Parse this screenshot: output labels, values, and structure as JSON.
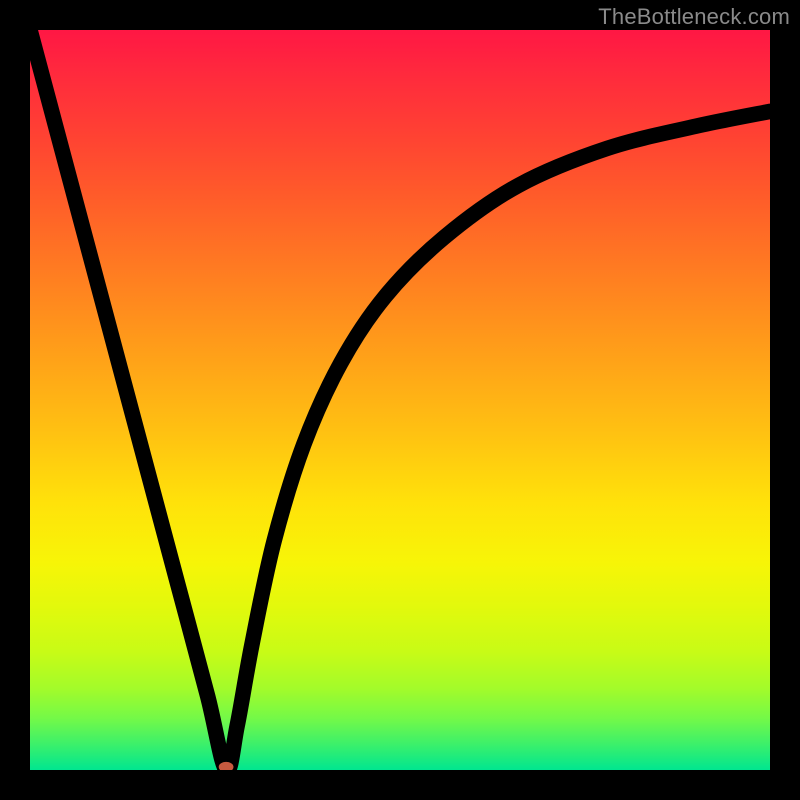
{
  "watermark": "TheBottleneck.com",
  "chart_data": {
    "type": "line",
    "title": "",
    "xlabel": "",
    "ylabel": "",
    "xlim": [
      0,
      100
    ],
    "ylim": [
      0,
      100
    ],
    "grid": false,
    "legend": false,
    "background_gradient": {
      "direction": "vertical",
      "stops": [
        {
          "pos": 0.0,
          "color": "#ff1744"
        },
        {
          "pos": 0.14,
          "color": "#ff4133"
        },
        {
          "pos": 0.32,
          "color": "#ff7a22"
        },
        {
          "pos": 0.54,
          "color": "#ffc012"
        },
        {
          "pos": 0.72,
          "color": "#f7f507"
        },
        {
          "pos": 0.84,
          "color": "#c8fb16"
        },
        {
          "pos": 0.93,
          "color": "#74f948"
        },
        {
          "pos": 1.0,
          "color": "#00e690"
        }
      ]
    },
    "series": [
      {
        "name": "bottleneck-curve",
        "x": [
          0,
          4,
          8,
          12,
          16,
          20,
          24,
          26.5,
          28,
          30,
          33,
          37,
          42,
          48,
          56,
          66,
          78,
          90,
          100
        ],
        "values": [
          100,
          85,
          70,
          55,
          40,
          25,
          10,
          0,
          6,
          17,
          31,
          44,
          55,
          64,
          72,
          79,
          84,
          87,
          89
        ]
      }
    ],
    "marker": {
      "name": "minimum-dot",
      "x": 26.5,
      "y": 0.4,
      "color": "#c65a3f",
      "rx": 1.0,
      "ry": 0.7
    }
  }
}
